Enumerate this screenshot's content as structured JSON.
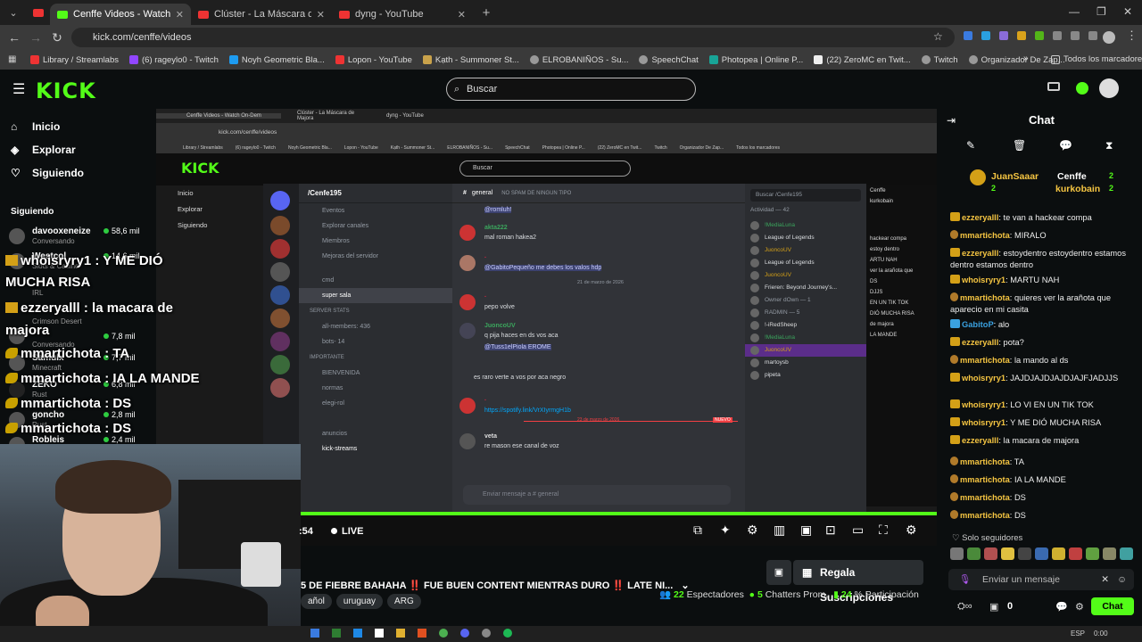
{
  "browser": {
    "tabs": [
      {
        "title": "Cenffe Videos - Watch On-Dem",
        "active": true,
        "kind": "kick"
      },
      {
        "title": "Clúster - La Máscara de Majora",
        "active": false,
        "kind": "yt"
      },
      {
        "title": "dyng - YouTube",
        "active": false,
        "kind": "yt"
      }
    ],
    "url": "kick.com/cenffe/videos",
    "bookmarks": [
      "Library / Streamlabs",
      "(6) rageylo0 - Twitch",
      "Noyh Geometric Bla...",
      "Lopon - YouTube",
      "Kạth - Summoner St...",
      "ELROBANIÑOS - Su...",
      "SpeechChat",
      "Photopea | Online P...",
      "(22) ZeroMC en Twit...",
      "Twitch",
      "Organizador De Zap..."
    ],
    "all_bookmarks": "Todos los marcadores"
  },
  "kick": {
    "logo": "KICK",
    "search_placeholder": "Buscar",
    "nav": [
      {
        "label": "Inicio",
        "icon": "home-icon"
      },
      {
        "label": "Explorar",
        "icon": "compass-icon"
      },
      {
        "label": "Siguiendo",
        "icon": "heart-icon"
      }
    ],
    "following_title": "Siguiendo",
    "channels": [
      {
        "name": "davooxeneize",
        "game": "Conversando",
        "viewers": "58,6 mil"
      },
      {
        "name": "Westcol",
        "game": "Slots & Casino",
        "viewers": "14,6 mil"
      },
      {
        "name": "",
        "game": "IRL",
        "viewers": ""
      },
      {
        "name": "",
        "game": "Crimson Desert",
        "viewers": ""
      },
      {
        "name": "",
        "game": "",
        "viewers": "7,8 mil"
      },
      {
        "name": "",
        "game": "Conversando",
        "viewers": ""
      },
      {
        "name": "Samulx",
        "game": "Minecraft",
        "viewers": "7,7 mil"
      },
      {
        "name": "ZEKO",
        "game": "Rust",
        "viewers": "6,8 mil"
      },
      {
        "name": "goncho",
        "game": "Rust",
        "viewers": "2,8 mil"
      },
      {
        "name": "Robleis",
        "game": "",
        "viewers": "2,4 mil"
      }
    ]
  },
  "overlay": [
    {
      "text": "whoisryry1 : Y ME DIÓ",
      "badge": true
    },
    {
      "text": "MUCHA RISA",
      "badge": false
    },
    {
      "text": "ezzeryalll : la macara de",
      "badge": true
    },
    {
      "text": "majora",
      "badge": false
    },
    {
      "text": "mmartichota : TA",
      "badge": true
    },
    {
      "text": "mmartichota : IA LA MANDE",
      "badge": true
    },
    {
      "text": "mmartichota : DS",
      "badge": true
    },
    {
      "text": "mmartichota : DS",
      "badge": true
    }
  ],
  "inner_stream": {
    "tabs": [
      "Cenffe Videos - Watch On-Dem",
      "Clúster - La Máscara de Majora",
      "dyng - YouTube"
    ],
    "url": "kick.com/cenffe/videos",
    "bookmarks": [
      "Library / Streamlabs",
      "(6) rageylo0 - Twitch",
      "Noyh Geometric Bla...",
      "Lopon - YouTube",
      "Kạth - Summoner St...",
      "ELROBANIÑOS - Su...",
      "SpeechChat",
      "Photopea | Online P...",
      "(22) ZeroMC en Twit...",
      "Twitch",
      "Organizador De Zap...",
      "Todos los marcadores"
    ],
    "nav": [
      "Inicio",
      "Explorar",
      "Siguiendo"
    ],
    "search": "Buscar",
    "discord": {
      "server": "/Cenfe195",
      "channels_top": [
        "Eventos",
        "Explorar canales",
        "Miembros",
        "Mejoras del servidor"
      ],
      "voice": [
        "cmd",
        "super sala"
      ],
      "cat1": "SERVER STATS",
      "stats": [
        "all-members: 436",
        "bots- 14"
      ],
      "cat2": "IMPORTANTE",
      "important": [
        "BIENVENIDA",
        "normas",
        "elegi-rol",
        "",
        "anuncios",
        "kick-streams"
      ],
      "channel": "general",
      "topic": "NO SPAM DE NINGUN TIPO",
      "messages": [
        {
          "author": "",
          "text": "@romluh!",
          "style": "mention"
        },
        {
          "author": "akta222",
          "time": "20/03/2026 17:04",
          "text": "mal roman hakea2",
          "style": ""
        },
        {
          "author": "",
          "time": "20/03/2026 21:12",
          "text": "@GabitoPequeño me debes los valos hdp",
          "style": "mention"
        },
        {
          "author": "",
          "time": "21/03/2026 0:36",
          "text": "pepo volve",
          "style": ""
        },
        {
          "author": "JuoncoUV",
          "time": "21/03/2026 4:49",
          "text": "q pija haces en ds vos aca",
          "style": ""
        },
        {
          "author": "",
          "text": "@Tuss1elPiola EROME",
          "style": "mention"
        },
        {
          "author": "",
          "text": "es raro verte a vos por aca negro",
          "style": ""
        },
        {
          "author": "",
          "time": "21/03/2026 16:56",
          "text": "https://spotify.link/VrXIyrmgH1b",
          "style": "link"
        },
        {
          "author": "veta",
          "time": "16:53",
          "text": "re mason ese canal de voz",
          "style": ""
        }
      ],
      "date1": "21 de marzo de 2026",
      "date2": "23 de marzo de 2026",
      "new": "NUEVO",
      "input": "Enviar mensaje a # general",
      "search": "Buscar /Cenfe195",
      "activity": "Actividad — 42",
      "members": [
        "!MediaLuna",
        "League of Legends",
        "JuoncoUV",
        "League of Legends",
        "JuoncoUV",
        "Frieren: Beyond Journey's...",
        "Owner dOwn — 1",
        "RADMIN — 5",
        "!-iRedSheep",
        "!MediaLuna",
        "JuoncoUV",
        "martoysb",
        "pipeta"
      ]
    },
    "chat_snips": [
      "Cenffe",
      "kurkobain",
      "hackear compa",
      "estoy dentro",
      "MARTU NAH",
      "ARTU NAH",
      "ver la arañota que",
      "DS",
      "DJJS",
      "EN UN TIK TOK",
      "DIÓ MUCHA RISA",
      "de majora",
      "LA MANDE"
    ]
  },
  "player": {
    "live": "LIVE",
    "time": ":54",
    "progress": 1.0
  },
  "stream_info": {
    "title": "5 DE FIEBRE BAHAHA ‼️ FUE BUEN CONTENT MIENTRAS DURO ‼️ LATE NI...",
    "tags": [
      "añol",
      "uruguay",
      "ARG"
    ],
    "subs_button": "Regala Suscripciones",
    "viewers": "22",
    "viewers_label": "Espectadores",
    "chatters": "5",
    "chatters_label": "Chatters Prom.",
    "participation": "24",
    "participation_label": "% Participación"
  },
  "chat": {
    "title": "Chat",
    "leaderboard": [
      {
        "user": "JuanSaaar",
        "count": "2"
      },
      {
        "user": "Cenffe",
        "count": "2"
      },
      {
        "user": "kurkobain",
        "count": "2"
      }
    ],
    "messages": [
      {
        "user": "ezzeryalll",
        "text": "te van a hackear compa",
        "color": "#f5c542",
        "badge": "sub"
      },
      {
        "user": "mmartichota",
        "text": "MIRALO",
        "color": "#f5c542",
        "badge": "small"
      },
      {
        "user": "ezzeryalll",
        "text": "estoydentro estoydentro estamos dentro estamos dentro",
        "color": "#f5c542",
        "badge": "sub"
      },
      {
        "user": "whoisryry1",
        "text": "MARTU NAH",
        "color": "#f5c542",
        "badge": "sub"
      },
      {
        "user": "mmartichota",
        "text": "quieres ver la arañota que aparecio en mi casita",
        "color": "#f5c542",
        "badge": "small"
      },
      {
        "user": "GabitoP",
        "text": "alo",
        "color": "#3aa1e0",
        "badge": "gift"
      },
      {
        "user": "ezzeryalll",
        "text": "pota?",
        "color": "#f5c542",
        "badge": "sub"
      },
      {
        "user": "mmartichota",
        "text": "la mando al ds",
        "color": "#f5c542",
        "badge": "small"
      },
      {
        "user": "whoisryry1",
        "text": "JAJDJAJDJAJDJAJFJADJJS",
        "color": "#f5c542",
        "badge": "sub"
      },
      {
        "user": "whoisryry1",
        "text": "LO VI EN UN TIK TOK",
        "color": "#f5c542",
        "badge": "sub"
      },
      {
        "user": "whoisryry1",
        "text": "Y ME DIÓ MUCHA RISA",
        "color": "#f5c542",
        "badge": "sub"
      },
      {
        "user": "ezzeryalll",
        "text": "la macara de majora",
        "color": "#f5c542",
        "badge": "sub"
      },
      {
        "user": "mmartichota",
        "text": "TA",
        "color": "#f5c542",
        "badge": "small"
      },
      {
        "user": "mmartichota",
        "text": "IA LA MANDE",
        "color": "#f5c542",
        "badge": "small"
      },
      {
        "user": "mmartichota",
        "text": "DS",
        "color": "#f5c542",
        "badge": "small"
      },
      {
        "user": "mmartichota",
        "text": "DS",
        "color": "#f5c542",
        "badge": "small"
      }
    ],
    "followers_only": "Solo seguidores",
    "input_placeholder": "Enviar un mensaje",
    "send_label": "Chat",
    "points": "0"
  },
  "taskbar": {
    "lang": "ESP",
    "time": "0:00"
  },
  "colors": {
    "accent": "#53fc18",
    "bg": "#0b0e0f",
    "username": "#f5c542"
  }
}
